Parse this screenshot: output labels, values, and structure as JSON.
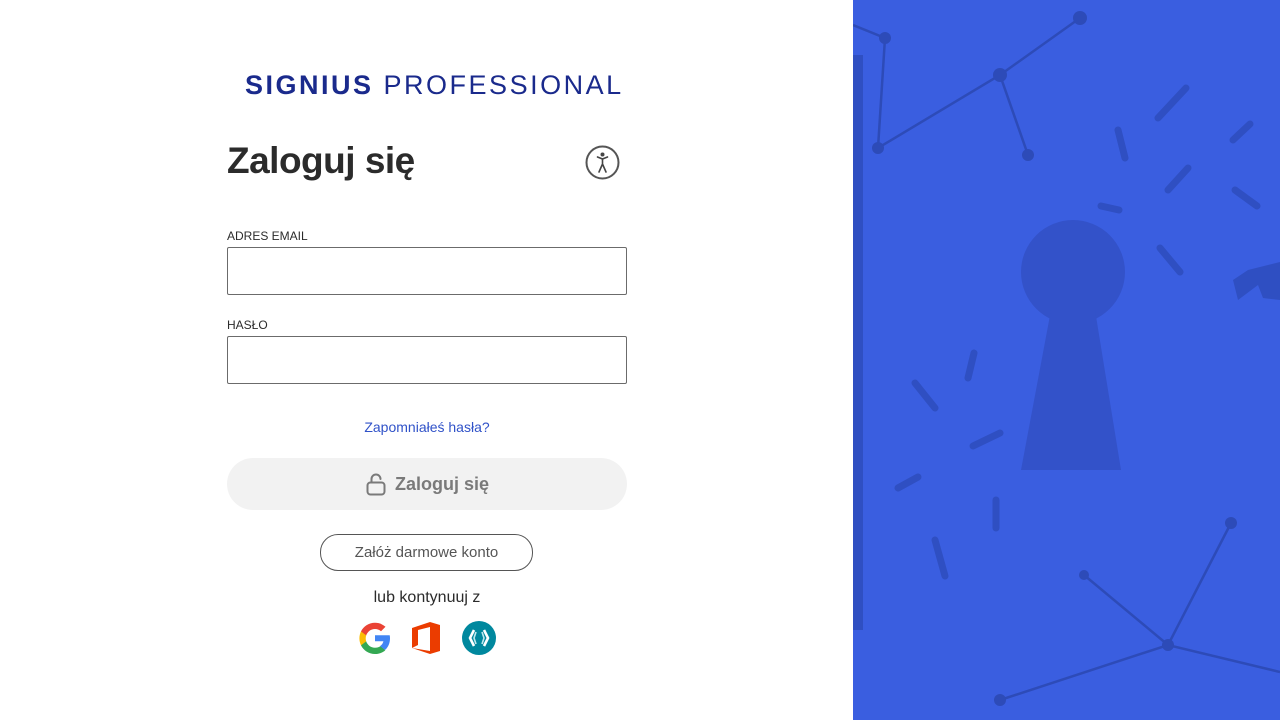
{
  "brand": {
    "name_bold": "SIGNIUS",
    "name_light": "PROFESSIONAL",
    "colors": {
      "navy": "#1a2a8c",
      "orange": "#f08a24",
      "panel_blue": "#3a5ee0",
      "link": "#3052c8"
    }
  },
  "heading": "Zaloguj się",
  "accessibility_icon": "accessibility-icon",
  "form": {
    "email_label": "ADRES EMAIL",
    "email_value": "",
    "email_placeholder": "",
    "password_label": "HASŁO",
    "password_value": "",
    "password_placeholder": "",
    "forgot_link": "Zapomniałeś hasła?",
    "login_button": "Zaloguj się",
    "login_icon": "unlock-icon"
  },
  "register_button": "Załóż darmowe konto",
  "alt_login_label": "lub kontynuuj z",
  "providers": [
    {
      "icon": "google-icon"
    },
    {
      "icon": "office-icon"
    },
    {
      "icon": "keycloak-icon"
    }
  ]
}
